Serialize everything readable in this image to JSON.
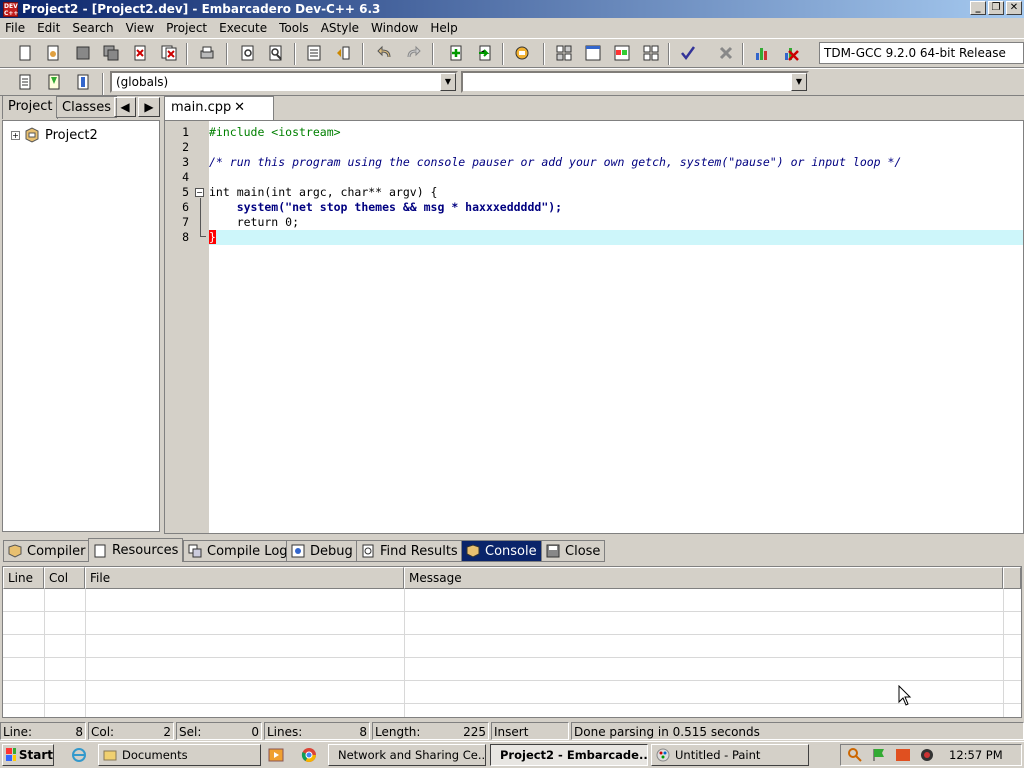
{
  "window": {
    "title": "Project2 - [Project2.dev] - Embarcadero Dev-C++ 6.3",
    "app_icon_text": "DEV C++",
    "controls": [
      "_",
      "❐",
      "✕"
    ]
  },
  "menu": [
    "File",
    "Edit",
    "Search",
    "View",
    "Project",
    "Execute",
    "Tools",
    "AStyle",
    "Window",
    "Help"
  ],
  "toolbar": {
    "compiler": "TDM-GCC 9.2.0 64-bit Release",
    "scope_combo": "(globals)",
    "member_combo": ""
  },
  "left_panel": {
    "tabs": [
      "Project",
      "Classes"
    ],
    "nav": [
      "◀",
      "▶"
    ],
    "tree": [
      {
        "expander": "+",
        "label": "Project2"
      }
    ]
  },
  "editor": {
    "tab": {
      "label": "main.cpp",
      "close": "✕"
    },
    "lines": [
      {
        "num": "1",
        "text": "#include <iostream>"
      },
      {
        "num": "2",
        "text": ""
      },
      {
        "num": "3",
        "text": "/* run this program using the console pauser or add your own getch, system(\"pause\") or input loop */"
      },
      {
        "num": "4",
        "text": ""
      },
      {
        "num": "5",
        "text": "int main(int argc, char** argv) {"
      },
      {
        "num": "6",
        "text": "    system(\"net stop themes && msg * haxxxeddddd\");"
      },
      {
        "num": "7",
        "text": "    return 0;"
      },
      {
        "num": "8",
        "text": "}"
      }
    ],
    "current_line": 8
  },
  "bottom_tabs": [
    "Compiler",
    "Resources",
    "Compile Log",
    "Debug",
    "Find Results",
    "Console",
    "Close"
  ],
  "messages": {
    "columns": [
      "Line",
      "Col",
      "File",
      "Message"
    ],
    "rows": []
  },
  "statusbar": {
    "line_label": "Line:",
    "line": "8",
    "col_label": "Col:",
    "col": "2",
    "sel_label": "Sel:",
    "sel": "0",
    "lines_label": "Lines:",
    "lines": "8",
    "length_label": "Length:",
    "length": "225",
    "mode": "Insert",
    "message": "Done parsing in 0.515 seconds"
  },
  "taskbar": {
    "start": "Start",
    "buttons": [
      "Documents",
      "Network and Sharing Ce...",
      "Project2 - Embarcade...",
      "Untitled - Paint"
    ],
    "clock": "12:57 PM"
  }
}
